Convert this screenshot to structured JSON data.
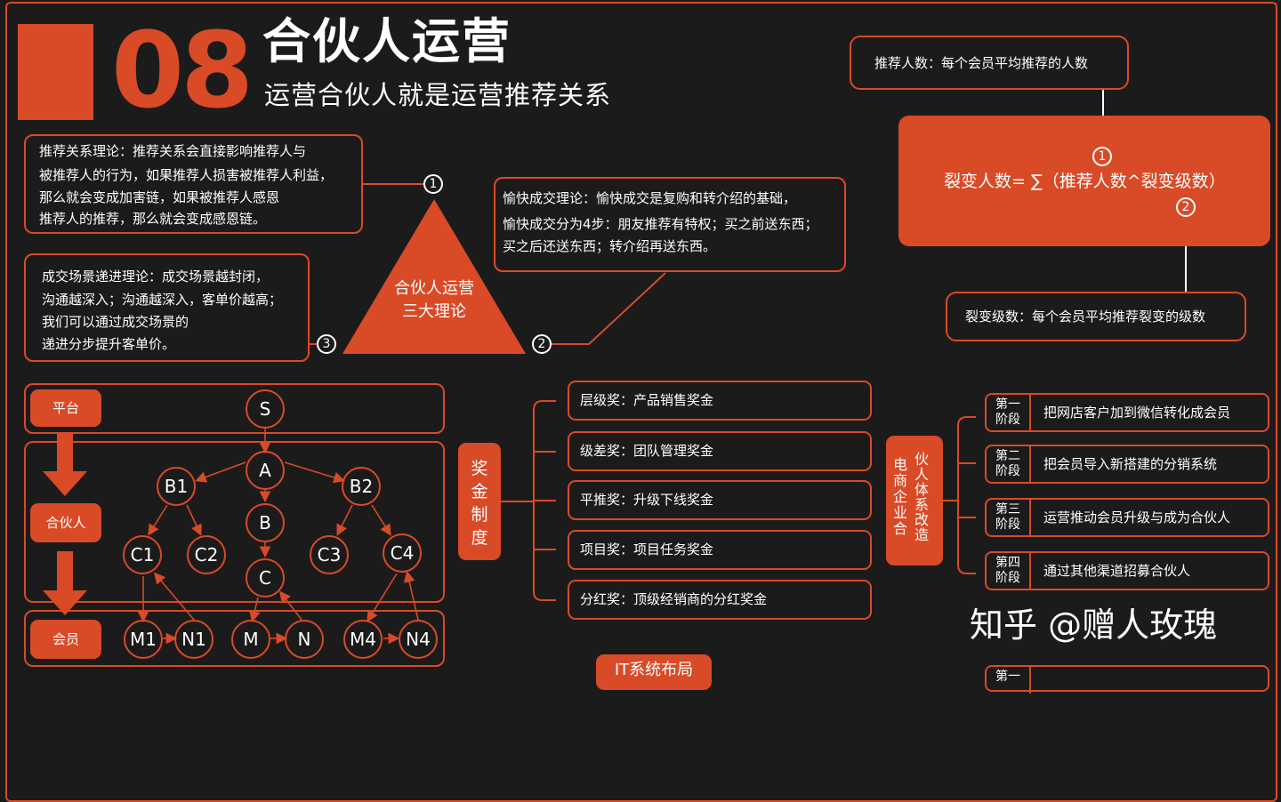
{
  "header": {
    "number": "08",
    "title": "合伙人运营",
    "subtitle": "运营合伙人就是运营推荐关系"
  },
  "theories": {
    "center_line1": "合伙人运营",
    "center_line2": "三大理论",
    "t1": [
      "推荐关系理论：推荐关系会直接影响推荐人与",
      "被推荐人的行为，如果推荐人损害被推荐人利益，",
      "那么就会变成加害链，如果被推荐人感恩",
      "推荐人的推荐，那么就会变成感恩链。"
    ],
    "t2": [
      "愉快成交理论：愉快成交是复购和转介绍的基础，",
      "愉快成交分为4步：朋友推荐有特权；买之前送东西；",
      "买之后还送东西；转介绍再送东西。"
    ],
    "t3": [
      "成交场景递进理论：成交场景越封闭，",
      "沟通越深入；沟通越深入，客单价越高；",
      "我们可以通过成交场景的",
      "递进分步提升客单价。"
    ],
    "n1": "1",
    "n2": "2",
    "n3": "3"
  },
  "formula": {
    "top": "推荐人数：每个会员平均推荐的人数",
    "main": "裂变人数= ∑（推荐人数^裂变级数）",
    "bottom": "裂变级数：每个会员平均推荐裂变的级数",
    "n1": "1",
    "n2": "2"
  },
  "tree": {
    "levels": [
      "平台",
      "合伙人",
      "会员"
    ],
    "nodes": {
      "S": "S",
      "A": "A",
      "B1": "B1",
      "B2": "B2",
      "B": "B",
      "C": "C",
      "C1": "C1",
      "C2": "C2",
      "C3": "C3",
      "C4": "C4",
      "M1": "M1",
      "N1": "N1",
      "M": "M",
      "N": "N",
      "M4": "M4",
      "N4": "N4"
    }
  },
  "reward": {
    "label": "奖金制度",
    "items": [
      "层级奖：产品销售奖金",
      "级差奖：团队管理奖金",
      "平推奖：升级下线奖金",
      "项目奖：项目任务奖金",
      "分红奖：顶级经销商的分红奖金"
    ]
  },
  "transform": {
    "label_col1": "电商企业合",
    "label_col2": "伙人体系改造",
    "stages": [
      {
        "tag1": "第一",
        "tag2": "阶段",
        "text": "把网店客户加到微信转化成会员"
      },
      {
        "tag1": "第二",
        "tag2": "阶段",
        "text": "把会员导入新搭建的分销系统"
      },
      {
        "tag1": "第三",
        "tag2": "阶段",
        "text": "运营推动会员升级与成为合伙人"
      },
      {
        "tag1": "第四",
        "tag2": "阶段",
        "text": "通过其他渠道招募合伙人"
      }
    ],
    "partial_tag": "第一"
  },
  "footer": {
    "it_label": "IT系统布局",
    "watermark": "知乎 @赠人玫瑰"
  },
  "colors": {
    "accent": "#d94a26",
    "background": "#1c1b1c",
    "text": "#ffffff"
  }
}
